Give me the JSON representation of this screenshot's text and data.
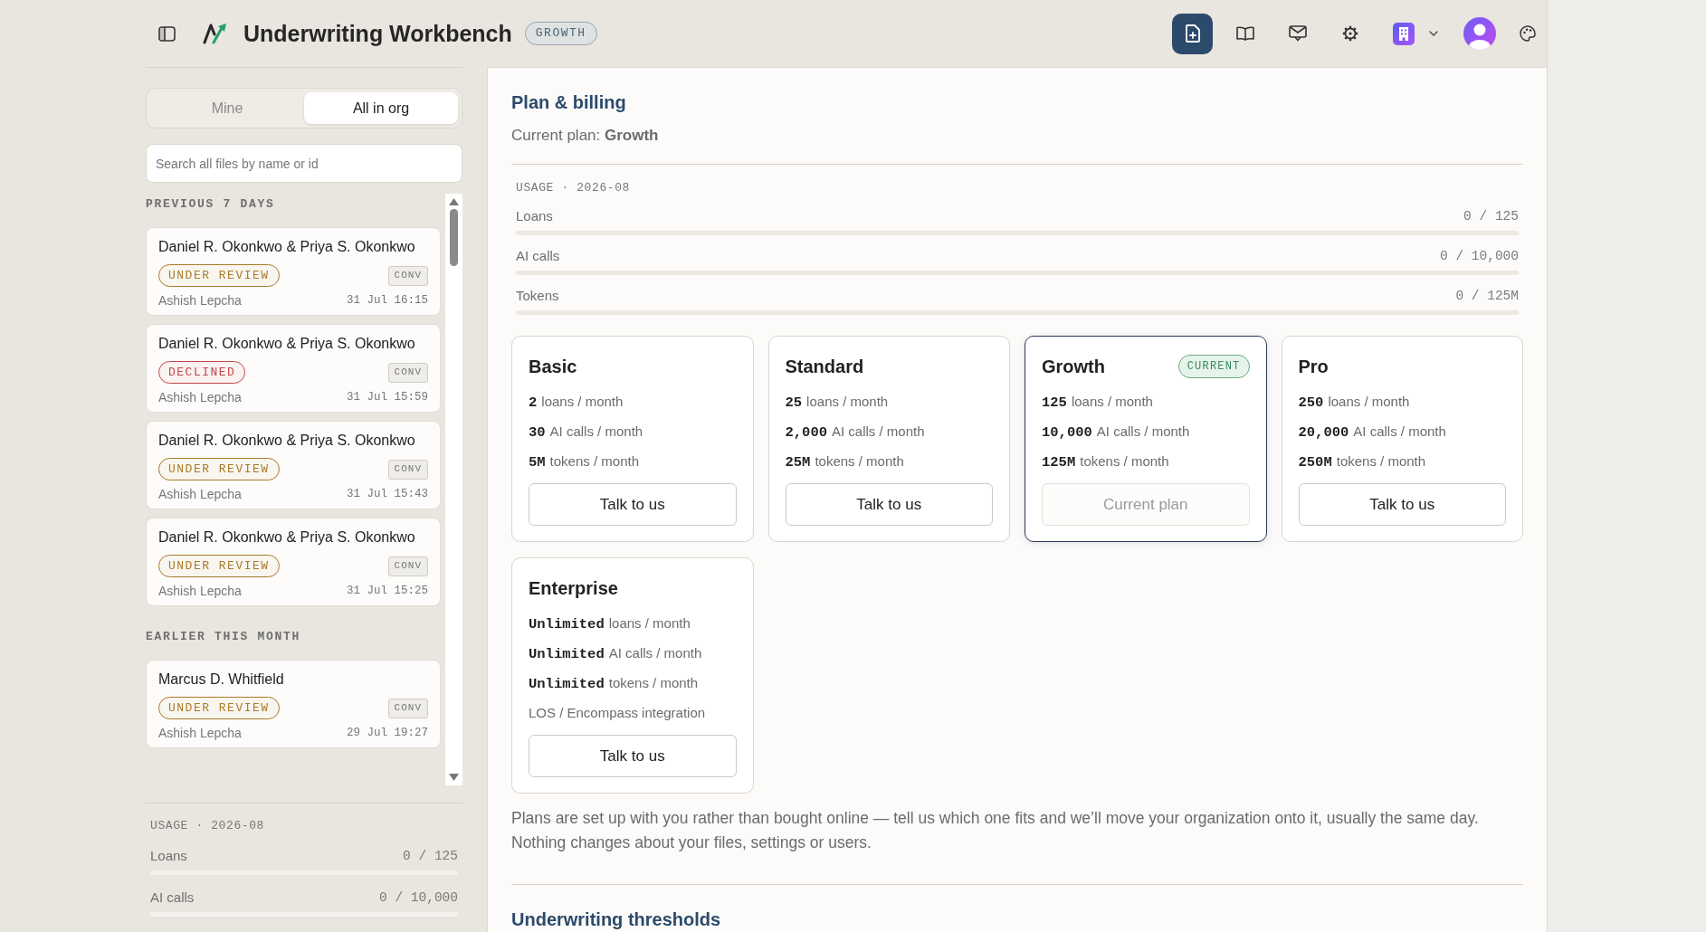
{
  "header": {
    "title": "Underwriting Workbench",
    "plan_badge": "GROWTH"
  },
  "sidebar": {
    "tabs": [
      {
        "label": "Mine",
        "selected": false
      },
      {
        "label": "All in org",
        "selected": true
      }
    ],
    "search": {
      "placeholder": "Search all files by name or id"
    },
    "sections": [
      {
        "title": "PREVIOUS 7 DAYS",
        "files": [
          {
            "name": "Daniel R. Okonkwo & Priya S. Okonkwo",
            "status": {
              "label": "UNDER REVIEW",
              "color": "#a87b2a"
            },
            "tag": "CONV",
            "owner": "Ashish Lepcha",
            "time": "31 Jul 16:15"
          },
          {
            "name": "Daniel R. Okonkwo & Priya S. Okonkwo",
            "status": {
              "label": "DECLINED",
              "color": "#c0474a"
            },
            "tag": "CONV",
            "owner": "Ashish Lepcha",
            "time": "31 Jul 15:59"
          },
          {
            "name": "Daniel R. Okonkwo & Priya S. Okonkwo",
            "status": {
              "label": "UNDER REVIEW",
              "color": "#a87b2a"
            },
            "tag": "CONV",
            "owner": "Ashish Lepcha",
            "time": "31 Jul 15:43"
          },
          {
            "name": "Daniel R. Okonkwo & Priya S. Okonkwo",
            "status": {
              "label": "UNDER REVIEW",
              "color": "#a87b2a"
            },
            "tag": "CONV",
            "owner": "Ashish Lepcha",
            "time": "31 Jul 15:25"
          }
        ]
      },
      {
        "title": "EARLIER THIS MONTH",
        "files": [
          {
            "name": "Marcus D. Whitfield",
            "status": {
              "label": "UNDER REVIEW",
              "color": "#a87b2a"
            },
            "tag": "CONV",
            "owner": "Ashish Lepcha",
            "time": "29 Jul 19:27"
          }
        ]
      }
    ],
    "usage": {
      "title": "USAGE · 2026-08",
      "meters": [
        {
          "label": "Loans",
          "reading": "0 / 125",
          "level": 0
        },
        {
          "label": "AI calls",
          "reading": "0 / 10,000",
          "level": 0
        }
      ]
    }
  },
  "main": {
    "title": "Plan & billing",
    "current_plan": "Current plan: **Growth**",
    "usage": {
      "title": "USAGE · 2026-08",
      "meters": [
        {
          "label": "Loans",
          "reading": "0 / 125",
          "level": 0
        },
        {
          "label": "AI calls",
          "reading": "0 / 10,000",
          "level": 0
        },
        {
          "label": "Tokens",
          "reading": "0 / 125M",
          "level": 0
        }
      ]
    },
    "plans": [
      {
        "name": "Basic",
        "current": false,
        "features": [
          {
            "value": "2",
            "text": "loans / month"
          },
          {
            "value": "30",
            "text": "AI calls / month"
          },
          {
            "value": "5M",
            "text": "tokens / month"
          }
        ],
        "button": {
          "label": "Talk to us",
          "disabled": false
        }
      },
      {
        "name": "Standard",
        "current": false,
        "features": [
          {
            "value": "25",
            "text": "loans / month"
          },
          {
            "value": "2,000",
            "text": "AI calls / month"
          },
          {
            "value": "25M",
            "text": "tokens / month"
          }
        ],
        "button": {
          "label": "Talk to us",
          "disabled": false
        }
      },
      {
        "name": "Growth",
        "current": true,
        "badge": "CURRENT",
        "features": [
          {
            "value": "125",
            "text": "loans / month"
          },
          {
            "value": "10,000",
            "text": "AI calls / month"
          },
          {
            "value": "125M",
            "text": "tokens / month"
          }
        ],
        "button": {
          "label": "Current plan",
          "disabled": true
        }
      },
      {
        "name": "Pro",
        "current": false,
        "features": [
          {
            "value": "250",
            "text": "loans / month"
          },
          {
            "value": "20,000",
            "text": "AI calls / month"
          },
          {
            "value": "250M",
            "text": "tokens / month"
          }
        ],
        "button": {
          "label": "Talk to us",
          "disabled": false
        }
      },
      {
        "name": "Enterprise",
        "current": false,
        "features": [
          {
            "value": "Unlimited",
            "text": "loans / month"
          },
          {
            "value": "Unlimited",
            "text": "AI calls / month"
          },
          {
            "value": "Unlimited",
            "text": "tokens / month"
          },
          {
            "text": "LOS / Encompass integration"
          }
        ],
        "button": {
          "label": "Talk to us",
          "disabled": false
        }
      }
    ],
    "note_lines": [
      "Plans are set up with you rather than bought online — tell us which one fits and we’ll move your organization onto it, usually the same day.",
      "Nothing changes about your files, settings or users."
    ],
    "next_section_title": "Underwriting thresholds"
  }
}
